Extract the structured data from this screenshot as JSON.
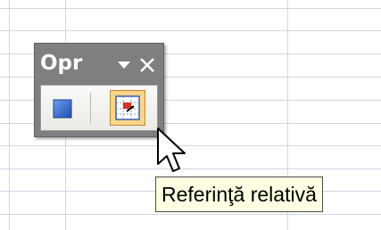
{
  "toolbar": {
    "title": "Opr",
    "menu_icon": "chevron-down-icon",
    "close_icon": "close-icon",
    "stop_button_icon": "stop-recording-icon",
    "relative_reference_icon": "relative-reference-icon"
  },
  "tooltip": {
    "text": "Referinţă relativă"
  },
  "colors": {
    "toolbar_bg": "#7f7f7f",
    "toolbar_body": "#f1f0ec",
    "button_active": "#fbd58a",
    "tooltip_bg": "#ffffe1",
    "stop_blue": "#2f62c9",
    "grid_line": "#d0d7e2"
  }
}
